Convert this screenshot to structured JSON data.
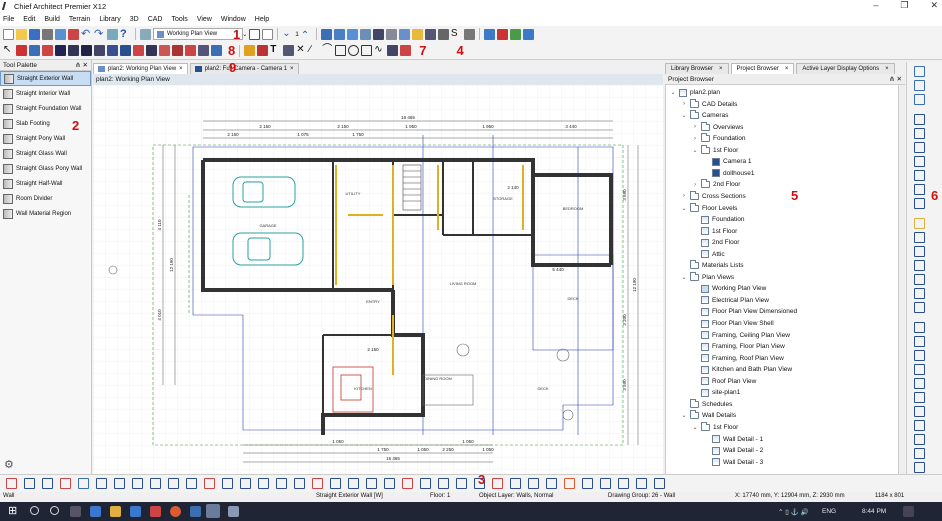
{
  "window": {
    "title": "Chief Architect Premier X12"
  },
  "menu": [
    "File",
    "Edit",
    "Build",
    "Terrain",
    "Library",
    "3D",
    "CAD",
    "Tools",
    "View",
    "Window",
    "Help"
  ],
  "toolbar": {
    "view_select": "Working Plan View",
    "floor_number": "1"
  },
  "annotations": [
    "1",
    "2",
    "3",
    "4",
    "5",
    "6",
    "7",
    "8",
    "9"
  ],
  "tool_palette": {
    "title": "Tool Palette",
    "items": [
      "Straight Exterior Wall",
      "Straight Interior Wall",
      "Straight Foundation Wall",
      "Slab Footing",
      "Straight Pony Wall",
      "Straight Glass Wall",
      "Straight Glass Pony Wall",
      "Straight Half-Wall",
      "Room Divider",
      "Wall Material Region"
    ],
    "selected": 0
  },
  "doc_tabs": [
    {
      "label": "plan2:  Working Plan View",
      "close": "×"
    },
    {
      "label": "plan2:  Full Camera - Camera 1",
      "close": "×"
    }
  ],
  "view_title": "plan2:  Working Plan View",
  "right_tabs": [
    {
      "label": "Library Browser",
      "close": "×"
    },
    {
      "label": "Project Browser",
      "close": "×"
    },
    {
      "label": "Active Layer Display Options",
      "close": "×"
    }
  ],
  "project_browser": {
    "title": "Project Browser",
    "tree": [
      {
        "label": "plan2.plan",
        "depth": 0,
        "chev": "⌄",
        "icon": "plan"
      },
      {
        "label": "CAD Details",
        "depth": 1,
        "chev": "›",
        "icon": "folder"
      },
      {
        "label": "Cameras",
        "depth": 1,
        "chev": "⌄",
        "icon": "folder"
      },
      {
        "label": "Overviews",
        "depth": 2,
        "chev": "›",
        "icon": "folder"
      },
      {
        "label": "Foundation",
        "depth": 2,
        "chev": "›",
        "icon": "folder"
      },
      {
        "label": "1st Floor",
        "depth": 2,
        "chev": "⌄",
        "icon": "folder"
      },
      {
        "label": "Camera 1",
        "depth": 3,
        "chev": "",
        "icon": "camera"
      },
      {
        "label": "dollhouse1",
        "depth": 3,
        "chev": "",
        "icon": "camera"
      },
      {
        "label": "2nd Floor",
        "depth": 2,
        "chev": "›",
        "icon": "folder"
      },
      {
        "label": "Cross Sections",
        "depth": 1,
        "chev": "›",
        "icon": "folder"
      },
      {
        "label": "Floor Levels",
        "depth": 1,
        "chev": "⌄",
        "icon": "folder"
      },
      {
        "label": "Foundation",
        "depth": 2,
        "chev": "",
        "icon": "page"
      },
      {
        "label": "1st Floor",
        "depth": 2,
        "chev": "",
        "icon": "page"
      },
      {
        "label": "2nd Floor",
        "depth": 2,
        "chev": "",
        "icon": "page"
      },
      {
        "label": "Attic",
        "depth": 2,
        "chev": "",
        "icon": "page"
      },
      {
        "label": "Materials Lists",
        "depth": 1,
        "chev": "",
        "icon": "folder"
      },
      {
        "label": "Plan Views",
        "depth": 1,
        "chev": "⌄",
        "icon": "folder"
      },
      {
        "label": "Working Plan View",
        "depth": 2,
        "chev": "",
        "icon": "open"
      },
      {
        "label": "Electrical Plan View",
        "depth": 2,
        "chev": "",
        "icon": "page"
      },
      {
        "label": "Floor Plan View Dimensioned",
        "depth": 2,
        "chev": "",
        "icon": "page"
      },
      {
        "label": "Floor Plan View Shell",
        "depth": 2,
        "chev": "",
        "icon": "page"
      },
      {
        "label": "Framing, Ceiling Plan View",
        "depth": 2,
        "chev": "",
        "icon": "page"
      },
      {
        "label": "Framing, Floor Plan View",
        "depth": 2,
        "chev": "",
        "icon": "page"
      },
      {
        "label": "Framing, Roof Plan View",
        "depth": 2,
        "chev": "",
        "icon": "page"
      },
      {
        "label": "Kitchen and Bath Plan View",
        "depth": 2,
        "chev": "",
        "icon": "page"
      },
      {
        "label": "Roof Plan View",
        "depth": 2,
        "chev": "",
        "icon": "page"
      },
      {
        "label": "site-plan1",
        "depth": 2,
        "chev": "",
        "icon": "page"
      },
      {
        "label": "Schedules",
        "depth": 1,
        "chev": "",
        "icon": "folder"
      },
      {
        "label": "Wall Details",
        "depth": 1,
        "chev": "⌄",
        "icon": "folder"
      },
      {
        "label": "1st Floor",
        "depth": 2,
        "chev": "⌄",
        "icon": "folder"
      },
      {
        "label": "Wall Detail - 1",
        "depth": 3,
        "chev": "",
        "icon": "detail"
      },
      {
        "label": "Wall Detail - 2",
        "depth": 3,
        "chev": "",
        "icon": "detail"
      },
      {
        "label": "Wall Detail - 3",
        "depth": 3,
        "chev": "",
        "icon": "detail"
      }
    ]
  },
  "plan": {
    "dims": [
      "16 465",
      "2 150",
      "2 150",
      "1 950",
      "1 950",
      "3 440",
      "2 150",
      "1 075",
      "1 750",
      "2 140",
      "5 440",
      "2 150",
      "1 050",
      "1 050",
      "1 750",
      "2 250",
      "1 050",
      "1 050",
      "16 465",
      "4 110",
      "4 010",
      "12 190",
      "12 190",
      "3 690",
      "3 200",
      "3 590"
    ],
    "rooms": [
      "GARAGE",
      "UTILITY",
      "ENTRY",
      "LIVING ROOM",
      "DECK",
      "KITCHEN",
      "DINING ROOM",
      "STORAGE",
      "BEDROOM",
      "DECK"
    ]
  },
  "status": {
    "left": "Wall",
    "tool": "Straight Exterior Wall [W]",
    "floor": "Floor: 1",
    "layer": "Object Layer: Walls,  Normal",
    "group": "Drawing Group: 26 - Wall",
    "coords": "X: 17740 mm, Y: 12904 mm, Z: 2930 mm",
    "size": "1184 x 801"
  },
  "taskbar": {
    "lang": "ENG",
    "time": "8:44 PM"
  }
}
